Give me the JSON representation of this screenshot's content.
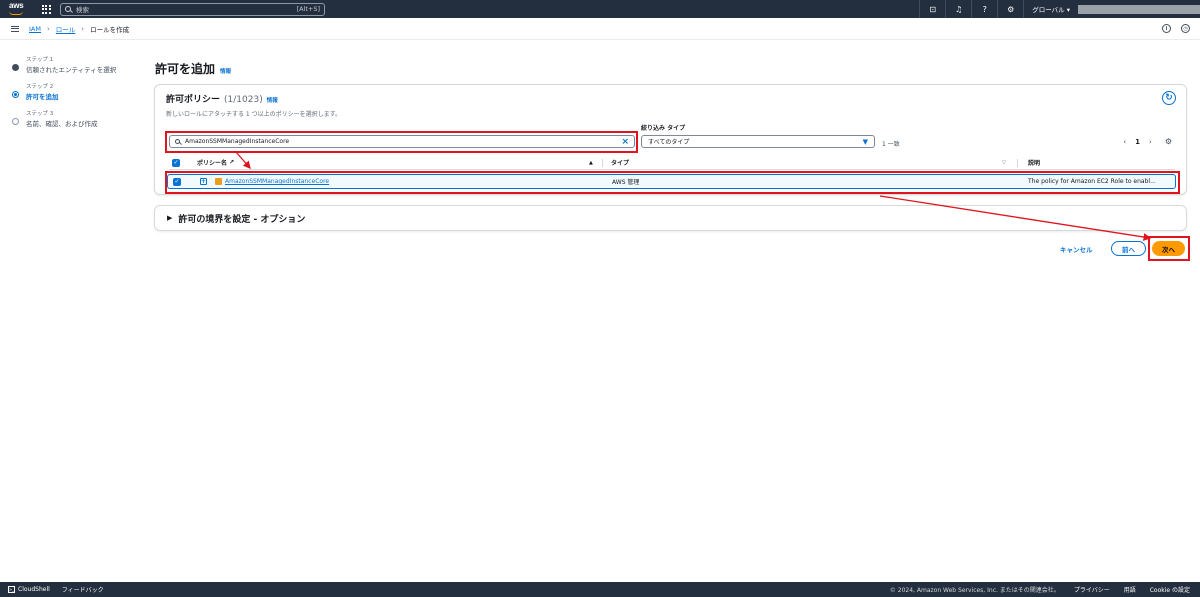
{
  "topnav": {
    "logo_text": "aws",
    "search_placeholder": "検索",
    "search_shortcut": "[Alt+S]",
    "region_label": "グローバル ▾"
  },
  "breadcrumb": {
    "items": [
      "IAM",
      "ロール"
    ],
    "current": "ロールを作成"
  },
  "steps": [
    {
      "label": "ステップ 1",
      "name": "信頼されたエンティティを選択",
      "state": "done"
    },
    {
      "label": "ステップ 2",
      "name": "許可を追加",
      "state": "active"
    },
    {
      "label": "ステップ 3",
      "name": "名前、確認、および作成",
      "state": "todo"
    }
  ],
  "page": {
    "title": "許可を追加",
    "info": "情報"
  },
  "policies_panel": {
    "title": "許可ポリシー",
    "count": "(1/1023)",
    "info": "情報",
    "description": "新しいロールにアタッチする 1 つ以上のポリシーを選択します。",
    "search_value": "AmazonSSMManagedInstanceCore",
    "filter_type_label": "絞り込み タイプ",
    "filter_type_value": "すべてのタイプ",
    "match_count": "1 一致",
    "page_number": "1",
    "columns": {
      "name": "ポリシー名",
      "type": "タイプ",
      "description": "説明"
    },
    "rows": [
      {
        "name": "AmazonSSMManagedInstanceCore",
        "type": "AWS 管理",
        "description": "The policy for Amazon EC2 Role to enabl...",
        "checked": true
      }
    ]
  },
  "boundary_panel": {
    "title": "許可の境界を設定 - オプション"
  },
  "actions": {
    "cancel": "キャンセル",
    "previous": "前へ",
    "next": "次へ"
  },
  "footer": {
    "cloudshell": "CloudShell",
    "feedback": "フィードバック",
    "copyright": "© 2024, Amazon Web Services, Inc. またはその関連会社。",
    "privacy": "プライバシー",
    "terms": "用語",
    "cookie": "Cookie の設定"
  },
  "colors": {
    "nav_bg": "#232f3e",
    "link": "#0972d3",
    "primary_button": "#ff9900",
    "annotation": "#e0141e"
  }
}
